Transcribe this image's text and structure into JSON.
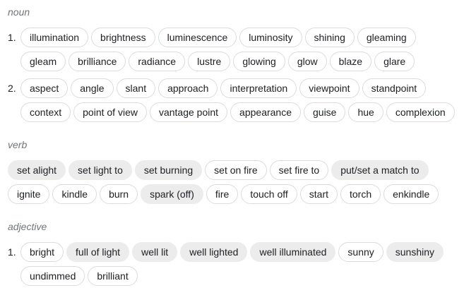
{
  "noun": {
    "label": "noun",
    "senses": [
      {
        "number": "1.",
        "rows": [
          [
            {
              "text": "illumination"
            },
            {
              "text": "brightness"
            },
            {
              "text": "luminescence"
            },
            {
              "text": "luminosity"
            },
            {
              "text": "shining"
            },
            {
              "text": "gleaming"
            }
          ],
          [
            {
              "text": "gleam"
            },
            {
              "text": "brilliance"
            },
            {
              "text": "radiance"
            },
            {
              "text": "lustre"
            },
            {
              "text": "glowing"
            },
            {
              "text": "glow"
            },
            {
              "text": "blaze"
            },
            {
              "text": "glare"
            }
          ]
        ]
      },
      {
        "number": "2.",
        "rows": [
          [
            {
              "text": "aspect"
            },
            {
              "text": "angle"
            },
            {
              "text": "slant"
            },
            {
              "text": "approach"
            },
            {
              "text": "interpretation"
            },
            {
              "text": "viewpoint"
            },
            {
              "text": "standpoint"
            }
          ],
          [
            {
              "text": "context"
            },
            {
              "text": "point of view"
            },
            {
              "text": "vantage point"
            },
            {
              "text": "appearance"
            },
            {
              "text": "guise"
            },
            {
              "text": "hue"
            },
            {
              "text": "complexion"
            }
          ]
        ]
      }
    ]
  },
  "verb": {
    "label": "verb",
    "rows": [
      [
        {
          "text": "set alight",
          "filled": true
        },
        {
          "text": "set light to",
          "filled": true
        },
        {
          "text": "set burning",
          "filled": true
        },
        {
          "text": "set on fire"
        },
        {
          "text": "set fire to"
        },
        {
          "text": "put/set a match to",
          "filled": true
        }
      ],
      [
        {
          "text": "ignite"
        },
        {
          "text": "kindle"
        },
        {
          "text": "burn"
        },
        {
          "text": "spark (off)",
          "filled": true
        },
        {
          "text": "fire"
        },
        {
          "text": "touch off"
        },
        {
          "text": "start"
        },
        {
          "text": "torch"
        },
        {
          "text": "enkindle"
        }
      ]
    ]
  },
  "adjective": {
    "label": "adjective",
    "senses": [
      {
        "number": "1.",
        "rows": [
          [
            {
              "text": "bright"
            },
            {
              "text": "full of light",
              "filled": true
            },
            {
              "text": "well lit",
              "filled": true
            },
            {
              "text": "well lighted",
              "filled": true
            },
            {
              "text": "well illuminated",
              "filled": true
            },
            {
              "text": "sunny"
            },
            {
              "text": "sunshiny",
              "filled": true
            }
          ],
          [
            {
              "text": "undimmed"
            },
            {
              "text": "brilliant"
            }
          ]
        ]
      }
    ]
  }
}
